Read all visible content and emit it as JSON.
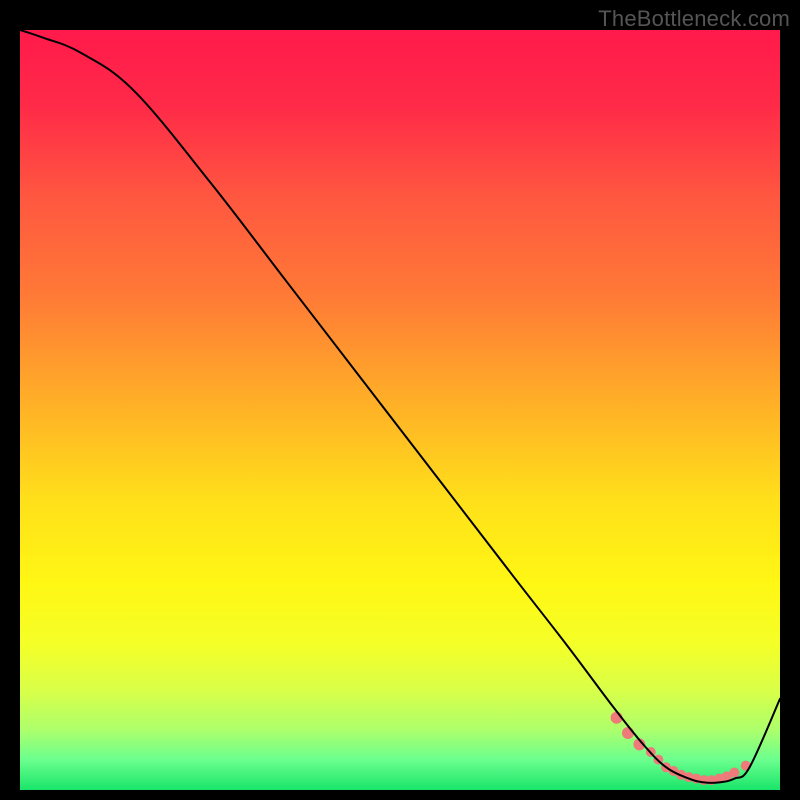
{
  "watermark": "TheBottleneck.com",
  "chart_data": {
    "type": "line",
    "title": "",
    "xlabel": "",
    "ylabel": "",
    "xlim": [
      0,
      100
    ],
    "ylim": [
      0,
      100
    ],
    "grid": false,
    "legend": false,
    "series": [
      {
        "name": "bottleneck-curve",
        "x": [
          0,
          3,
          8,
          15,
          25,
          35,
          45,
          55,
          65,
          72,
          78,
          82,
          85,
          88,
          90,
          92,
          94,
          96,
          100
        ],
        "y": [
          100,
          99,
          97,
          92,
          80,
          67,
          54,
          41,
          28,
          19,
          11,
          6,
          3,
          1.5,
          1,
          1,
          1.5,
          3,
          12
        ],
        "color": "#000000",
        "stroke_width": 2
      }
    ],
    "markers": {
      "name": "highlight-range",
      "color": "#ee7a7a",
      "x": [
        78.5,
        80,
        81.5,
        83,
        84,
        85,
        86,
        87,
        88,
        89,
        90,
        91,
        92,
        93,
        94,
        95.5
      ],
      "y": [
        9.5,
        7.5,
        6,
        5,
        4,
        3,
        2.5,
        2,
        1.7,
        1.5,
        1.3,
        1.3,
        1.5,
        1.8,
        2.3,
        3.2
      ],
      "size": [
        12,
        12,
        12,
        10,
        10,
        10,
        10,
        10,
        10,
        10,
        10,
        10,
        10,
        10,
        10,
        10
      ]
    },
    "gradient_stops": [
      {
        "offset": 0.0,
        "color": "#ff1a4b"
      },
      {
        "offset": 0.1,
        "color": "#ff2a48"
      },
      {
        "offset": 0.22,
        "color": "#ff5740"
      },
      {
        "offset": 0.35,
        "color": "#ff7a36"
      },
      {
        "offset": 0.5,
        "color": "#ffb326"
      },
      {
        "offset": 0.62,
        "color": "#ffe01a"
      },
      {
        "offset": 0.73,
        "color": "#fff714"
      },
      {
        "offset": 0.81,
        "color": "#f4ff28"
      },
      {
        "offset": 0.87,
        "color": "#d8ff49"
      },
      {
        "offset": 0.92,
        "color": "#aeff6b"
      },
      {
        "offset": 0.96,
        "color": "#6bff8e"
      },
      {
        "offset": 1.0,
        "color": "#19e56a"
      }
    ]
  }
}
